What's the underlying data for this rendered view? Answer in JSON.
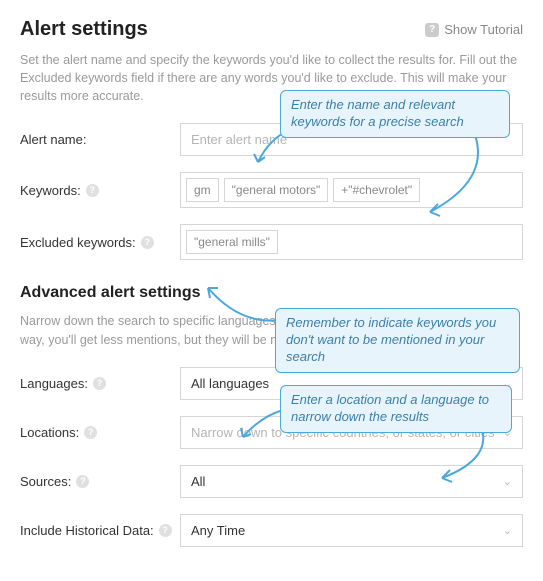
{
  "header": {
    "title": "Alert settings",
    "tutorial": "Show Tutorial"
  },
  "desc1": "Set the alert name and specify the keywords you'd like to collect the results for. Fill out the Excluded keywords field if there are any words you'd like to exclude. This will make your results more accurate.",
  "fields": {
    "alert_name": {
      "label": "Alert name:",
      "placeholder": "Enter alert name"
    },
    "keywords": {
      "label": "Keywords:",
      "tags": [
        "gm",
        "\"general motors\"",
        "+\"#chevrolet\""
      ]
    },
    "excluded": {
      "label": "Excluded keywords:",
      "tags": [
        "\"general mills\""
      ]
    }
  },
  "advanced_title": "Advanced alert settings",
  "desc2": "Narrow down the search to specific languages, locations, sources, and date range. This way, you'll get less mentions, but they will be more accurate.",
  "adv": {
    "languages": {
      "label": "Languages:",
      "value": "All languages"
    },
    "locations": {
      "label": "Locations:",
      "placeholder": "Narrow down to specific countries, or states, or cities"
    },
    "sources": {
      "label": "Sources:",
      "value": "All"
    },
    "historical": {
      "label": "Include Historical Data:",
      "value": "Any Time"
    }
  },
  "callouts": {
    "c1": "Enter the name and relevant keywords for a precise search",
    "c2": "Remember to indicate keywords you don't want to be mentioned in your search",
    "c3": "Enter a location and a language to narrow down the results"
  }
}
